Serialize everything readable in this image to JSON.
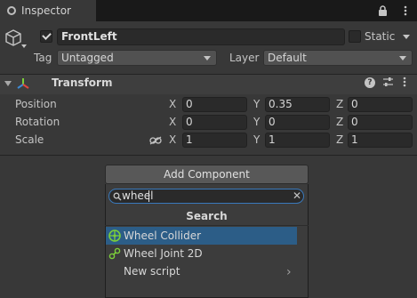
{
  "tab": {
    "title": "Inspector"
  },
  "object": {
    "name": "FrontLeft",
    "static_label": "Static",
    "tag_label": "Tag",
    "tag_value": "Untagged",
    "layer_label": "Layer",
    "layer_value": "Default"
  },
  "transform": {
    "title": "Transform",
    "rows": [
      {
        "label": "Position",
        "x": "0",
        "y": "0.35",
        "z": "0"
      },
      {
        "label": "Rotation",
        "x": "0",
        "y": "0",
        "z": "0"
      },
      {
        "label": "Scale",
        "x": "1",
        "y": "1",
        "z": "1"
      }
    ],
    "axis_labels": {
      "x": "X",
      "y": "Y",
      "z": "Z"
    }
  },
  "add_component": {
    "button_label": "Add Component",
    "search_value": "wheel",
    "search_heading": "Search",
    "results": [
      {
        "label": "Wheel Collider",
        "icon": "wheel-collider-icon",
        "selected": true
      },
      {
        "label": "Wheel Joint 2D",
        "icon": "wheel-joint-2d-icon",
        "selected": false
      },
      {
        "label": "New script",
        "icon": "",
        "selected": false
      }
    ]
  },
  "colors": {
    "background": "#383838",
    "selection": "#2c5d87",
    "search_focus": "#3a79bb",
    "component_icon_green": "#7ccf3a"
  }
}
